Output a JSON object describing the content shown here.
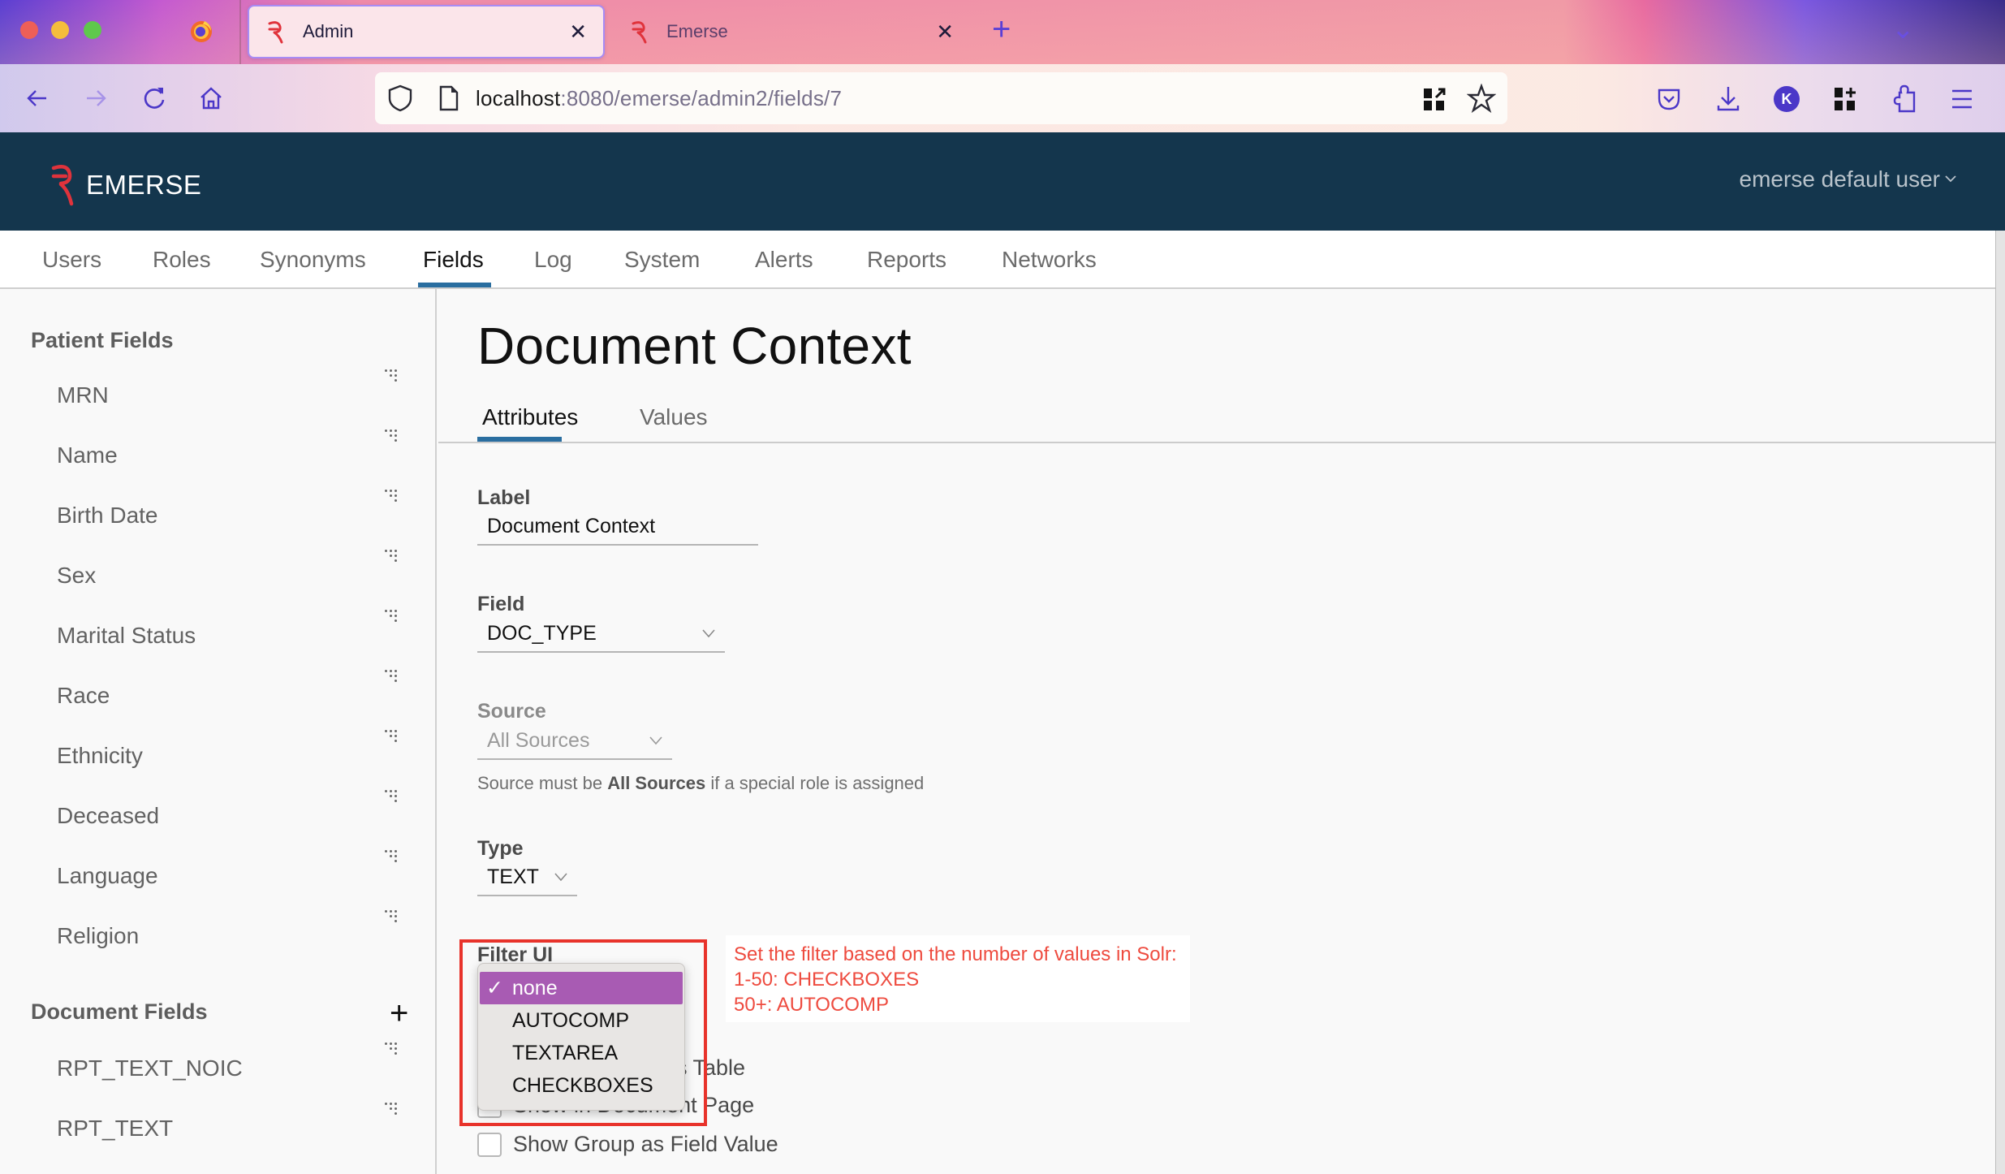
{
  "browser": {
    "tabs": [
      {
        "title": "Admin",
        "active": true,
        "favicon": "emerse-logo-icon"
      },
      {
        "title": "Emerse",
        "active": false,
        "favicon": "emerse-logo-icon"
      }
    ],
    "close_glyph": "✕",
    "new_tab_glyph": "+",
    "tab_list_glyph": "⌄",
    "url_host": "localhost",
    "url_rest": ":8080/emerse/admin2/fields/7",
    "profile_initial": "K"
  },
  "app": {
    "logo_text": "EMERSE",
    "user_menu": "emerse default user",
    "user_menu_chevron": "⌄",
    "nav": [
      {
        "label": "Users",
        "active": false
      },
      {
        "label": "Roles",
        "active": false
      },
      {
        "label": "Synonyms",
        "active": false
      },
      {
        "label": "Fields",
        "active": true
      },
      {
        "label": "Log",
        "active": false
      },
      {
        "label": "System",
        "active": false
      },
      {
        "label": "Alerts",
        "active": false
      },
      {
        "label": "Reports",
        "active": false
      },
      {
        "label": "Networks",
        "active": false
      }
    ]
  },
  "sidebar": {
    "patient_heading": "Patient Fields",
    "patient_items": [
      "MRN",
      "Name",
      "Birth Date",
      "Sex",
      "Marital Status",
      "Race",
      "Ethnicity",
      "Deceased",
      "Language",
      "Religion"
    ],
    "document_heading": "Document Fields",
    "document_add_glyph": "+",
    "document_items": [
      "RPT_TEXT_NOIC",
      "RPT_TEXT"
    ]
  },
  "main": {
    "title": "Document Context",
    "tabs": [
      {
        "label": "Attributes",
        "active": true
      },
      {
        "label": "Values",
        "active": false
      }
    ],
    "label_field": {
      "label": "Label",
      "value": "Document Context"
    },
    "field_select": {
      "label": "Field",
      "value": "DOC_TYPE"
    },
    "source_select": {
      "label": "Source",
      "value": "All Sources",
      "disabled": true,
      "help_prefix": "Source must be ",
      "help_bold": "All Sources",
      "help_suffix": " if a special role is assigned"
    },
    "type_select": {
      "label": "Type",
      "value": "TEXT"
    },
    "filter_ui": {
      "label": "Filter UI",
      "selected": "none",
      "check_glyph": "✓",
      "options": [
        "none",
        "AUTOCOMP",
        "TEXTAREA",
        "CHECKBOXES"
      ]
    },
    "annotation": {
      "color": "#e8332b",
      "lines": [
        "Set the filter based on the number of values in Solr:",
        "1-50: CHECKBOXES",
        "50+: AUTOCOMP"
      ]
    },
    "checkboxes": [
      {
        "label_visible": "es Table",
        "checked": false,
        "occluded": true
      },
      {
        "label": "Show in Document Page",
        "checked": false,
        "occluded": true
      },
      {
        "label": "Show Group as Field Value",
        "checked": false,
        "occluded": false
      }
    ]
  },
  "colors": {
    "header_bg": "#14364d",
    "accent_blue": "#2a6ea0",
    "dropdown_highlight": "#a85bb3",
    "annotation_red": "#e8332b"
  }
}
